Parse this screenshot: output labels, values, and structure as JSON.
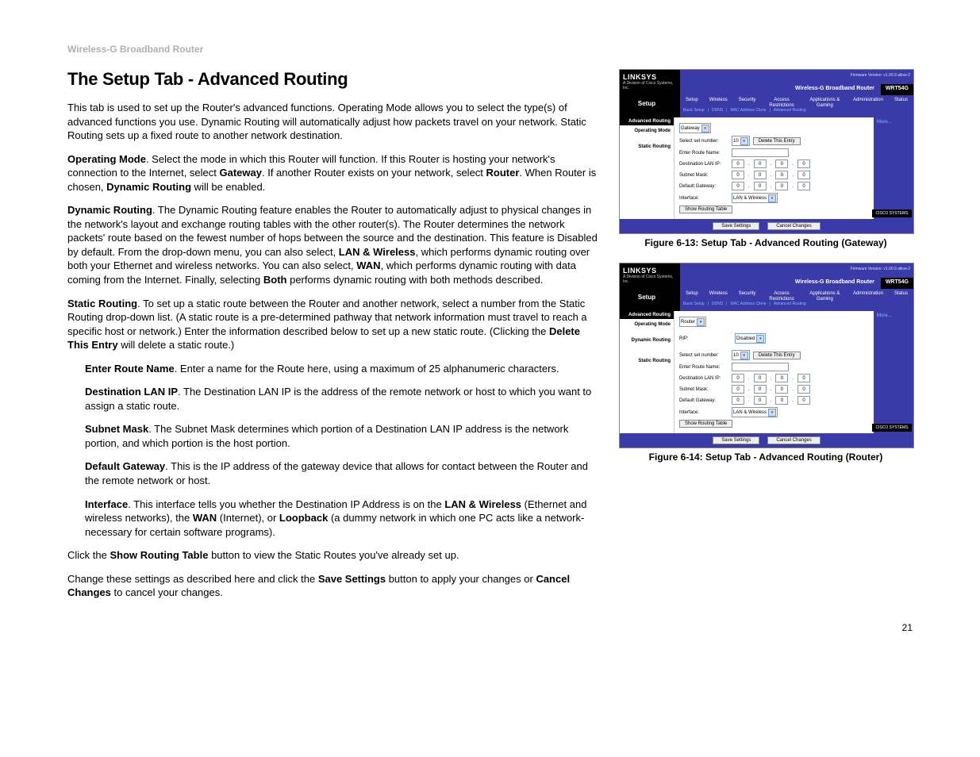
{
  "header": "Wireless-G Broadband Router",
  "title": "The Setup Tab - Advanced Routing",
  "page_number": "21",
  "intro": "This tab is used to set up the Router's advanced functions. Operating Mode allows you to select the type(s) of advanced functions you use. Dynamic Routing will automatically adjust how packets travel on your network. Static Routing sets up a fixed route to another network destination.",
  "p_om": {
    "b1": "Operating Mode",
    "t1": ". Select the mode in which this Router will function. If this Router is hosting your network's connection to the Internet, select ",
    "b2": "Gateway",
    "t2": ". If another Router exists on your network, select ",
    "b3": "Router",
    "t3": ". When Router is chosen, ",
    "b4": "Dynamic Routing",
    "t4": " will be enabled."
  },
  "p_dr": {
    "b1": "Dynamic Routing",
    "t1": ". The Dynamic Routing feature enables the Router to automatically adjust to physical changes in the network's layout and exchange routing tables with the other router(s). The Router determines the network packets' route based on the fewest number of hops between the source and the destination. This feature is Disabled by default. From the drop-down menu, you can also select, ",
    "b2": "LAN & Wireless",
    "t2": ", which performs dynamic routing over both your Ethernet and wireless networks. You can also select, ",
    "b3": "WAN",
    "t3": ", which performs dynamic routing with data coming from the Internet. Finally, selecting ",
    "b4": "Both",
    "t4": " performs dynamic routing with both methods described."
  },
  "p_sr": {
    "b1": "Static Routing",
    "t1": ". To set up a static route between the Router and another network, select a number from the Static Routing drop-down list. (A static route is a pre-determined pathway that network information must travel to reach a specific host or network.) Enter the information described below to set up a new static route. (Clicking the ",
    "b2": "Delete This Entry",
    "t2": " will delete a static route.)"
  },
  "li_route": {
    "b1": "Enter Route Name",
    "t1": ". Enter a name for the Route here, using a maximum of 25 alphanumeric characters."
  },
  "li_dest": {
    "b1": "Destination LAN IP",
    "t1": ". The Destination LAN IP is the address of the remote network or host to which you want to assign a static route."
  },
  "li_subnet": {
    "b1": "Subnet Mask",
    "t1": ". The Subnet Mask determines which portion of a Destination LAN IP address is the network portion, and which portion is the host portion."
  },
  "li_gw": {
    "b1": "Default Gateway",
    "t1": ". This is the IP address of the gateway device that allows for contact between the Router and the remote network or host."
  },
  "li_if": {
    "b1": "Interface",
    "t1": ". This interface tells you whether the Destination IP Address is on the ",
    "b2": "LAN & Wireless",
    "t2": " (Ethernet and wireless networks), the ",
    "b3": "WAN",
    "t3": " (Internet), or ",
    "b4": "Loopback",
    "t4": " (a dummy network in which one PC acts like a network-necessary for certain software programs)."
  },
  "p_show": {
    "t1": "Click the ",
    "b1": "Show Routing Table",
    "t2": " button to view the Static Routes you've already set up."
  },
  "p_save": {
    "t1": "Change these settings as described here and click the ",
    "b1": "Save Settings",
    "t2": " button to apply your changes or ",
    "b2": "Cancel Changes",
    "t3": " to cancel your changes."
  },
  "caption1": "Figure 6-13: Setup Tab - Advanced Routing (Gateway)",
  "caption2": "Figure 6-14: Setup Tab - Advanced Routing (Router)",
  "ui": {
    "logo": "LINKSYS",
    "sublogo": "A Division of Cisco Systems, Inc.",
    "firmware": "Firmware Version: v1.00.9 allow-2",
    "model_text": "Wireless-G Broadband Router",
    "model_code": "WRT54G",
    "tabs": [
      "Setup",
      "Wireless",
      "Security",
      "Access\nRestrictions",
      "Applications\n& Gaming",
      "Administration",
      "Status"
    ],
    "subtabs": [
      "Basic Setup",
      "|",
      "DDNS",
      "|",
      "MAC Address Clone",
      "|",
      "Advanced Routing"
    ],
    "setup_label": "Setup",
    "side_hdr": "Advanced Routing",
    "side_op": "Operating Mode",
    "side_dyn": "Dynamic Routing",
    "side_stat": "Static Routing",
    "more": "More...",
    "cisco": "CISCO SYSTEMS",
    "gateway_val": "Gateway",
    "router_val": "Router",
    "rip_label": "RIP:",
    "disabled_val": "Disabled",
    "select_set": "Select set number:",
    "set_val": "10",
    "delete_btn": "Delete This Entry",
    "route_name": "Enter Route Name:",
    "dest_ip": "Destination LAN IP:",
    "subnet": "Subnet Mask:",
    "def_gw": "Default Gateway:",
    "iface": "Interface:",
    "iface_val": "LAN & Wireless",
    "show_rt": "Show Routing Table",
    "ip0": "0",
    "save": "Save Settings",
    "cancel": "Cancel Changes"
  }
}
